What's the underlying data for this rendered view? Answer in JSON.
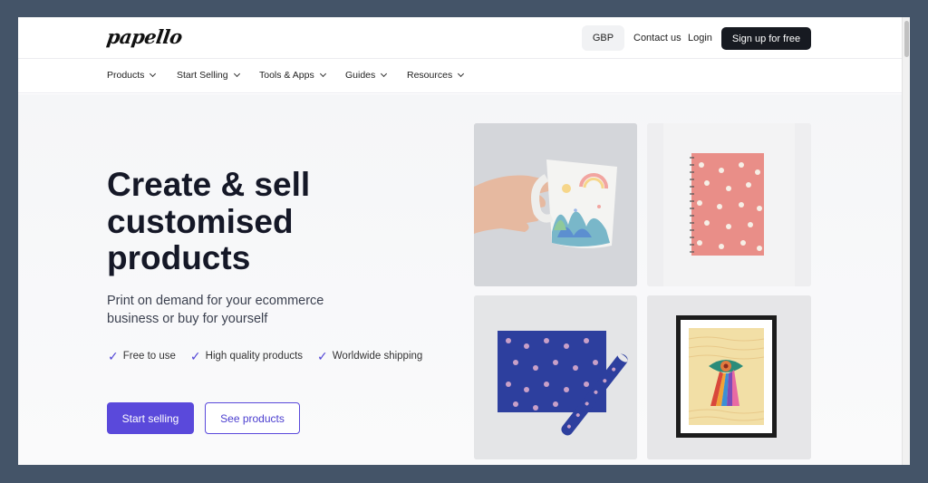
{
  "brand": {
    "logo_text": "papello"
  },
  "header": {
    "currency": "GBP",
    "contact_label": "Contact us",
    "login_label": "Login",
    "signup_label": "Sign up for free"
  },
  "nav": {
    "items": [
      {
        "label": "Products"
      },
      {
        "label": "Start Selling"
      },
      {
        "label": "Tools & Apps"
      },
      {
        "label": "Guides"
      },
      {
        "label": "Resources"
      }
    ]
  },
  "hero": {
    "headline": "Create & sell customised products",
    "subheadline": "Print on demand for your ecommerce business or buy for yourself",
    "features": [
      {
        "label": "Free to use"
      },
      {
        "label": "High quality products"
      },
      {
        "label": "Worldwide shipping"
      }
    ],
    "primary_cta": "Start selling",
    "secondary_cta": "See products"
  },
  "gallery": {
    "items": [
      {
        "product": "mug"
      },
      {
        "product": "notebook"
      },
      {
        "product": "wrapping-paper"
      },
      {
        "product": "framed-print"
      }
    ]
  },
  "colors": {
    "accent": "#5a49db",
    "dark": "#171a21",
    "frame_background": "#445468"
  }
}
